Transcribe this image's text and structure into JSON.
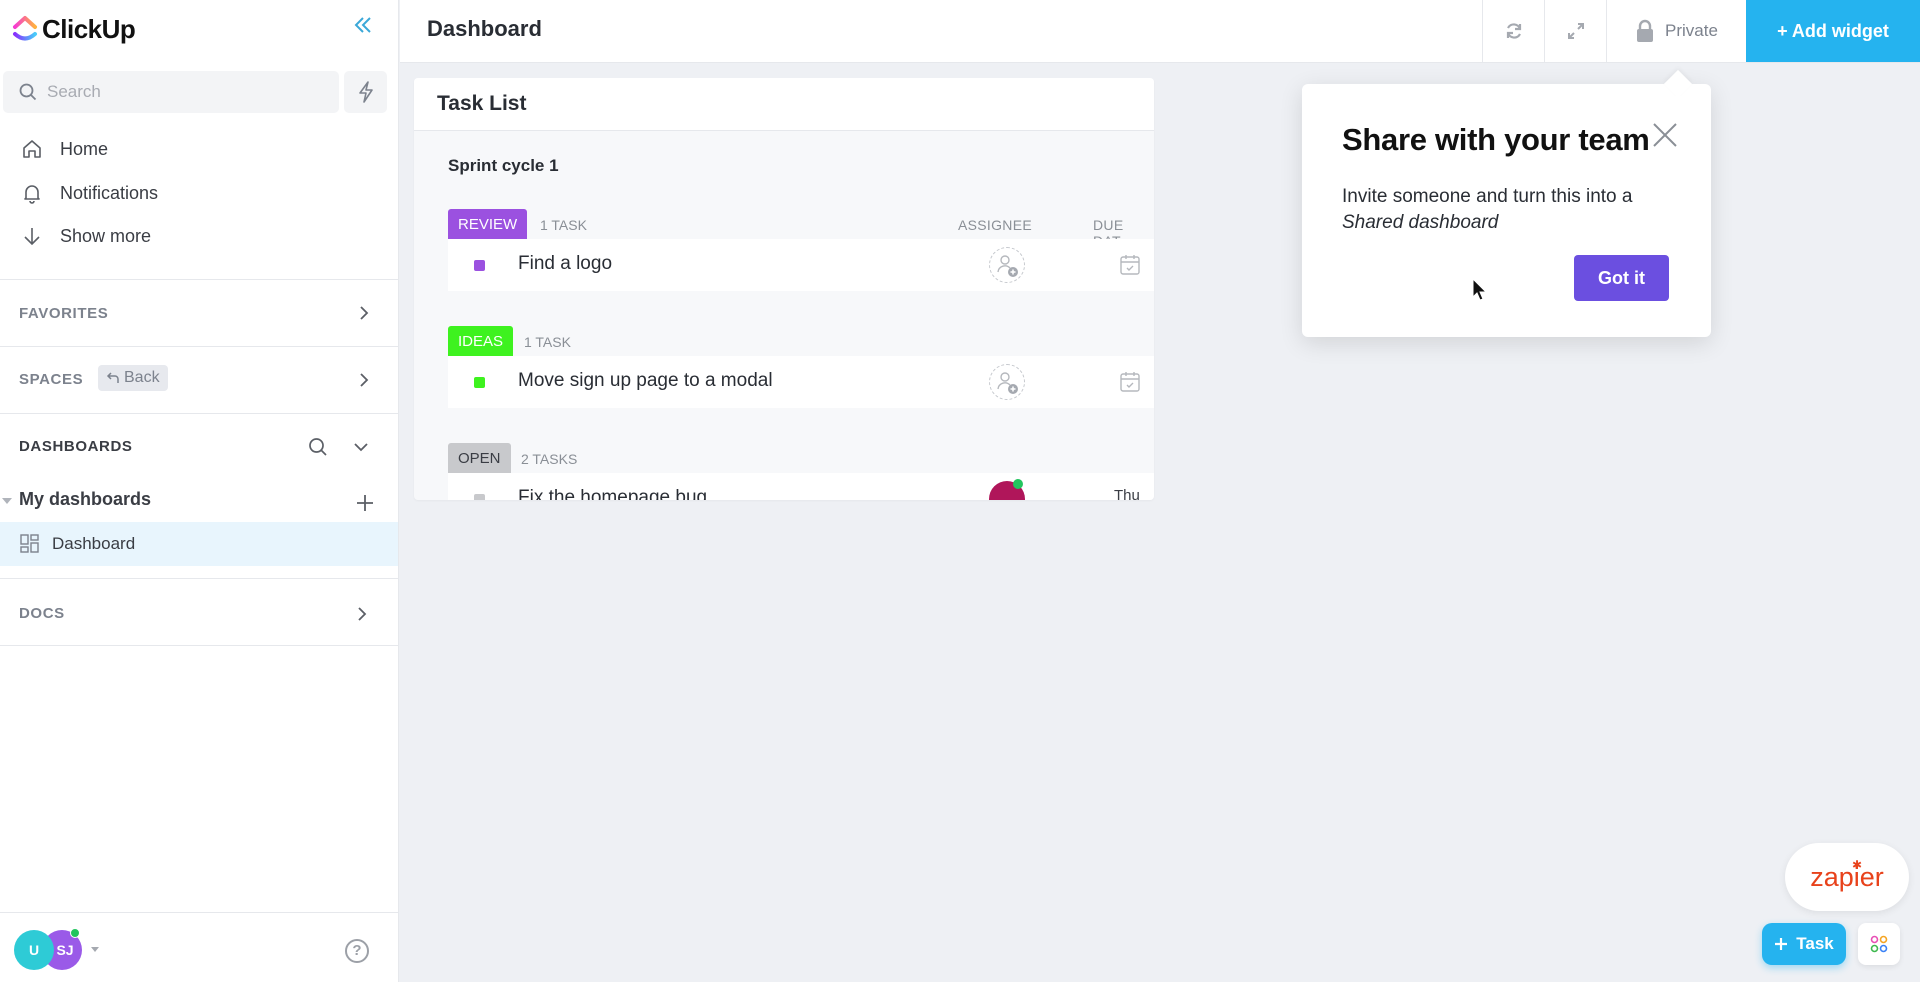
{
  "app": {
    "name": "ClickUp",
    "colors": {
      "accent": "#25b3ef",
      "primary_button": "#6b4fe0",
      "review": "#9b51e0",
      "ideas": "#3ef21f",
      "open": "#c8c9cc"
    }
  },
  "sidebar": {
    "collapse_icon": "double-chevron-left-icon",
    "search": {
      "placeholder": "Search",
      "value": ""
    },
    "nav": [
      {
        "label": "Home",
        "icon": "home-icon"
      },
      {
        "label": "Notifications",
        "icon": "bell-icon"
      },
      {
        "label": "Show more",
        "icon": "arrow-down-icon"
      }
    ],
    "sections": {
      "favorites": "FAVORITES",
      "spaces": "SPACES",
      "spaces_back": "Back",
      "dashboards": "DASHBOARDS",
      "docs": "DOCS"
    },
    "my_dashboards": "My dashboards",
    "dashboard_item": "Dashboard",
    "footer": {
      "avatar_1": "U",
      "avatar_2": "SJ",
      "help": "?"
    }
  },
  "topbar": {
    "title": "Dashboard",
    "private_label": "Private",
    "add_widget_label": "+ Add widget"
  },
  "widget": {
    "title": "Task List",
    "sprint": "Sprint cycle 1",
    "columns": {
      "assignee": "ASSIGNEE",
      "due_date": "DUE DAT"
    },
    "groups": [
      {
        "status": "REVIEW",
        "count": "1 TASK",
        "color": "#9b51e0",
        "tasks": [
          {
            "name": "Find a logo"
          }
        ]
      },
      {
        "status": "IDEAS",
        "count": "1 TASK",
        "color": "#3ef21f",
        "tasks": [
          {
            "name": "Move sign up page to a modal"
          }
        ]
      },
      {
        "status": "OPEN",
        "count": "2 TASKS",
        "color": "#c8c9cc",
        "tasks": [
          {
            "name": "Fix the homepage bug",
            "due": "Thu"
          }
        ]
      }
    ]
  },
  "popover": {
    "title": "Share with your team",
    "body_line1": "Invite someone and turn this into a",
    "body_em": "Shared dashboard",
    "button": "Got it"
  },
  "floating": {
    "zapier": "zapier",
    "new_task": "Task"
  }
}
